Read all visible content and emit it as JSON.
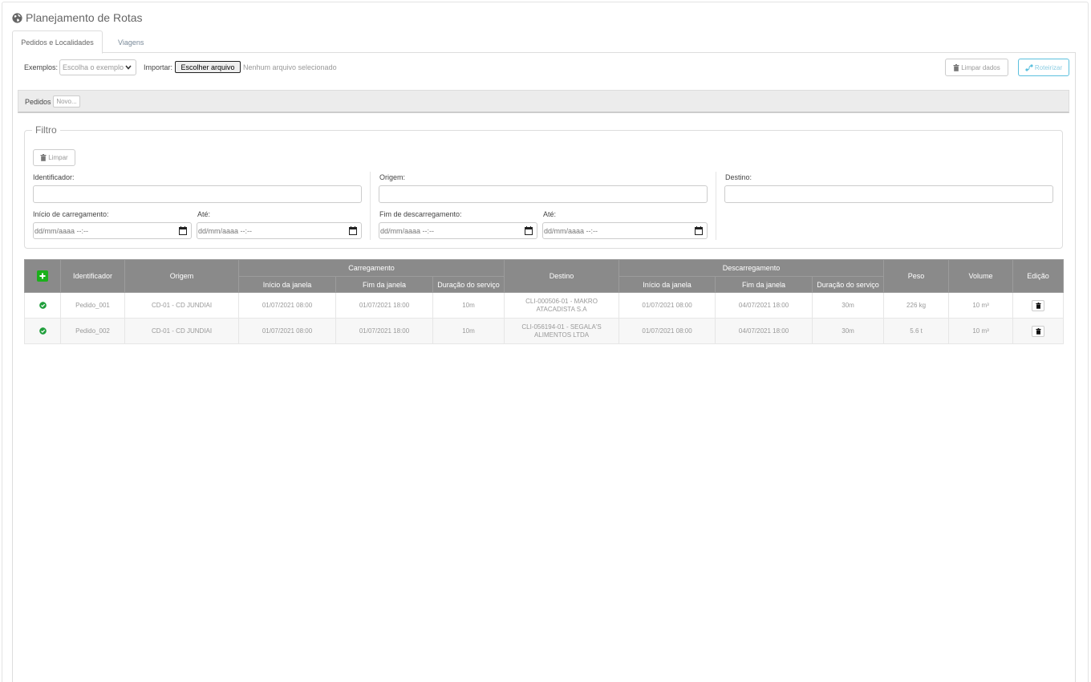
{
  "page": {
    "title": "Planejamento de Rotas",
    "tabs": [
      {
        "label": "Pedidos e Localidades",
        "active": true
      },
      {
        "label": "Viagens",
        "active": false
      }
    ]
  },
  "toolbar": {
    "examples_label": "Exemplos:",
    "examples_selected": "Escolha o exemplo",
    "import_label": "Importar:",
    "file_button": "Escolher arquivo",
    "file_status": "Nenhum arquivo selecionado",
    "clear_data": "Limpar dados",
    "route": "Roteirizar"
  },
  "orders_bar": {
    "label": "Pedidos",
    "new_button": "Novo..."
  },
  "filter": {
    "legend": "Filtro",
    "clear_button": "Limpar",
    "identificador_label": "Identificador:",
    "origem_label": "Origem:",
    "destino_label": "Destino:",
    "inicio_carregamento_label": "Início de carregamento:",
    "ate_label_1": "Até:",
    "fim_descarregamento_label": "Fim de descarregamento:",
    "ate_label_2": "Até:",
    "date_placeholder": "dd/mm/aaaa --:--"
  },
  "table": {
    "headers": {
      "identificador": "Identificador",
      "origem": "Origem",
      "carregamento": "Carregamento",
      "destino": "Destino",
      "descarregamento": "Descarregamento",
      "peso": "Peso",
      "volume": "Volume",
      "edicao": "Edição",
      "inicio_janela": "Início da janela",
      "fim_janela": "Fim da janela",
      "duracao_servico": "Duração do serviço"
    },
    "rows": [
      {
        "identificador": "Pedido_001",
        "origem": "CD-01 - CD JUNDIAI",
        "carga_inicio": "01/07/2021 08:00",
        "carga_fim": "01/07/2021 18:00",
        "carga_duracao": "10m",
        "destino_1": "CLI-000506-01 - MAKRO",
        "destino_2": "ATACADISTA S.A",
        "descarga_inicio": "01/07/2021 08:00",
        "descarga_fim": "04/07/2021 18:00",
        "descarga_duracao": "30m",
        "peso": "226 kg",
        "volume": "10 m³"
      },
      {
        "identificador": "Pedido_002",
        "origem": "CD-01 - CD JUNDIAI",
        "carga_inicio": "01/07/2021 08:00",
        "carga_fim": "01/07/2021 18:00",
        "carga_duracao": "10m",
        "destino_1": "CLI-056194-01 - SEGALA'S",
        "destino_2": "ALIMENTOS LTDA",
        "descarga_inicio": "01/07/2021 08:00",
        "descarga_fim": "04/07/2021 18:00",
        "descarga_duracao": "30m",
        "peso": "5.6 t",
        "volume": "10 m³"
      }
    ]
  },
  "icons": {
    "globe": "globe-icon",
    "trash": "trash-icon",
    "route": "route-icon",
    "add": "plus-icon",
    "status": "check-circle-icon",
    "delete": "trash-icon",
    "calendar": "calendar-icon",
    "chevron": "chevron-down-icon"
  },
  "colors": {
    "add_green": "#1bb01b",
    "status_green": "#1e9e3a",
    "route_blue": "#5bc0de",
    "header_gray": "#8a8a8a"
  }
}
